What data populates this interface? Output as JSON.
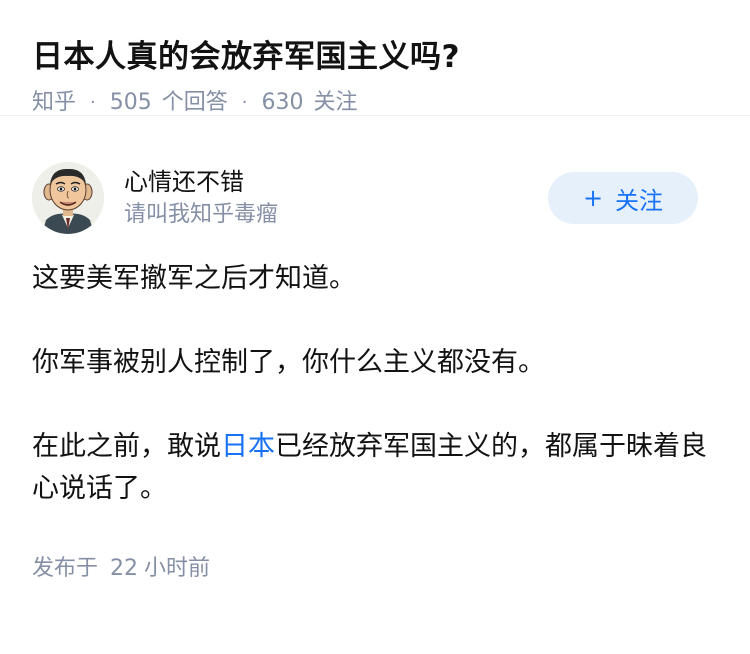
{
  "question": {
    "title": "日本人真的会放弃军国主义吗?",
    "source": "知乎",
    "answer_count": "505",
    "answer_label": "个回答",
    "follower_count": "630",
    "follower_label": "关注"
  },
  "answer": {
    "author_name": "心情还不错",
    "author_bio": "请叫我知乎毒瘤",
    "follow_button": "关注",
    "follow_icon": "plus-icon",
    "paragraphs": {
      "p1": "这要美军撤军之后才知道。",
      "p2": "你军事被别人控制了，你什么主义都没有。",
      "p3_before": "在此之前，敢说",
      "p3_link": "日本",
      "p3_after": "已经放弃军国主义的，都属于昧着良心说话了。"
    },
    "publish_prefix": "发布于",
    "publish_num": "22",
    "publish_suffix": "小时前"
  },
  "colors": {
    "accent": "#1772f6",
    "follow_bg": "#e5f0fb",
    "meta": "#8590a6",
    "text": "#121212"
  }
}
